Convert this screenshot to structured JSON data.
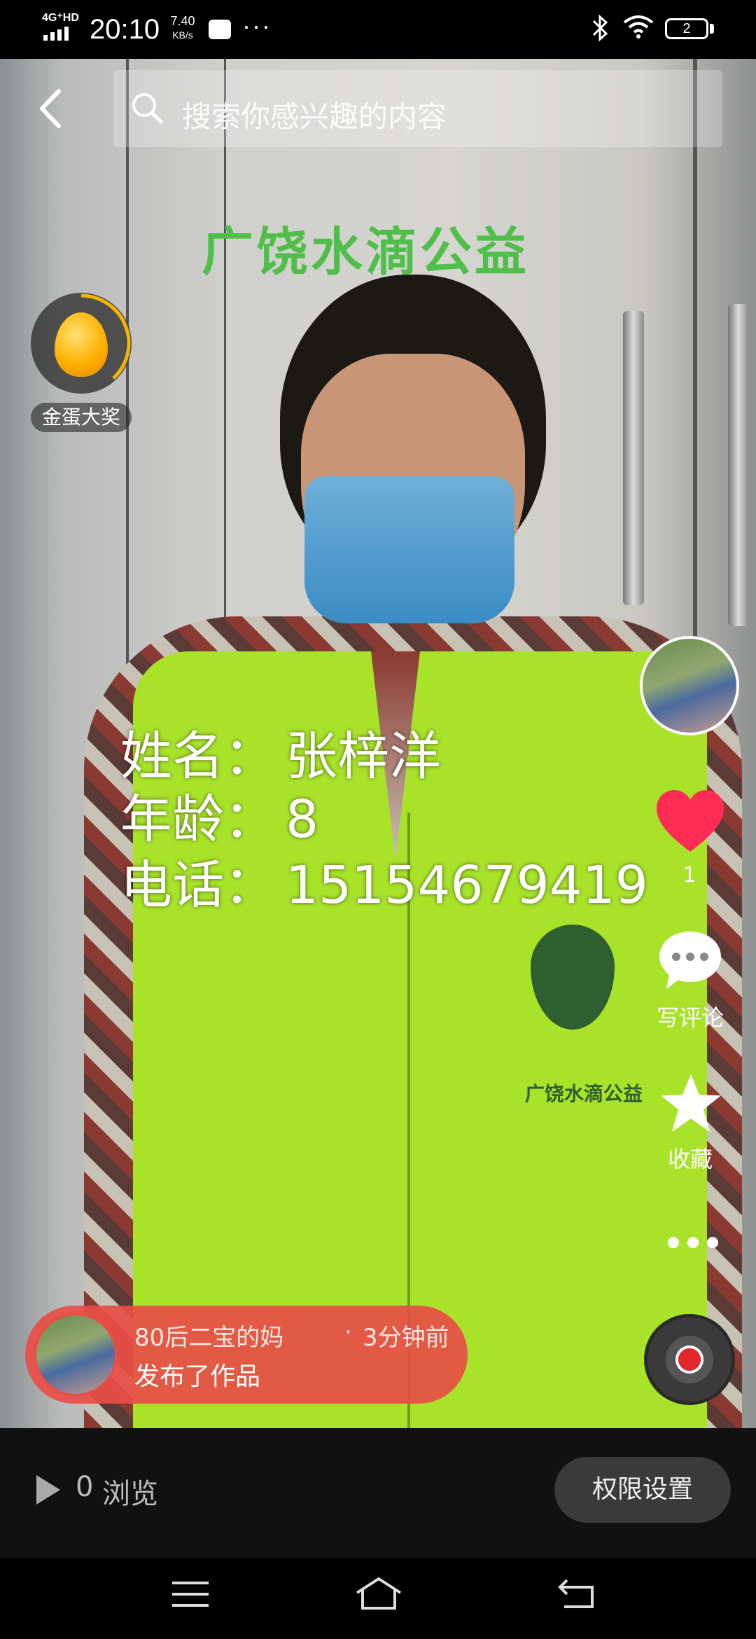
{
  "status_bar": {
    "network": "4G⁺HD",
    "time": "20:10",
    "speed_value": "7.40",
    "speed_unit": "KB/s",
    "more": "···",
    "battery": "2"
  },
  "search": {
    "placeholder": "搜索你感兴趣的内容"
  },
  "wall_sign": "广饶水滴公益",
  "vest_logo_text": "广饶水滴公益",
  "golden_egg": {
    "label": "金蛋大奖"
  },
  "caption": {
    "name_label": "姓名：",
    "name_value": "张梓洋",
    "age_label": "年龄：",
    "age_value": "8",
    "phone_label": "电话：",
    "phone_value": "15154679419"
  },
  "actions": {
    "like_count": "1",
    "comment_label": "写评论",
    "favorite_label": "收藏"
  },
  "toast": {
    "user": "80后二宝的妈",
    "separator": "·",
    "time": "3分钟前",
    "action": "发布了作品"
  },
  "bottom": {
    "view_count": "0",
    "view_label": "浏览",
    "permission_button": "权限设置"
  },
  "colors": {
    "like": "#ff2d55",
    "toast_bg": "#e84e46",
    "vest": "#a8e32a"
  }
}
